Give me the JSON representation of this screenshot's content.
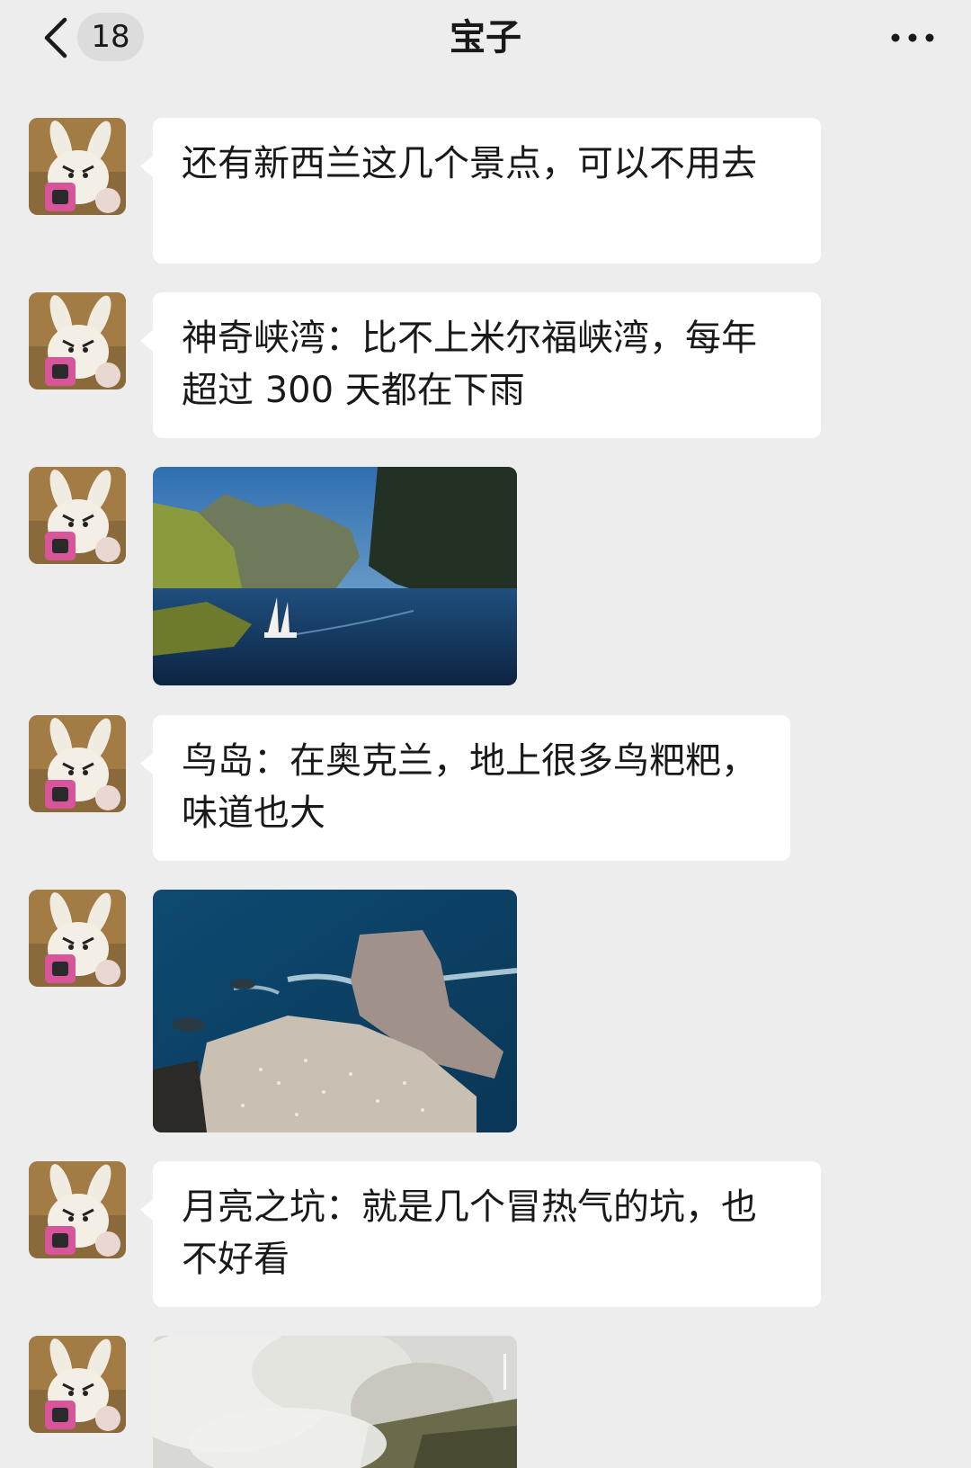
{
  "header": {
    "unread_count": "18",
    "title": "宝子"
  },
  "messages": [
    {
      "type": "text",
      "text": "还有新西兰这几个景点，可以不用去"
    },
    {
      "type": "text",
      "text": "神奇峡湾：比不上米尔福峡湾，每年超过 300 天都在下雨"
    },
    {
      "type": "image",
      "subject": "fiord with sailing ship"
    },
    {
      "type": "text",
      "text": "鸟岛：在奥克兰，地上很多鸟粑粑，味道也大"
    },
    {
      "type": "image",
      "subject": "gannet colony on rocky headland"
    },
    {
      "type": "text",
      "text": "月亮之坑：就是几个冒热气的坑，也不好看"
    },
    {
      "type": "image",
      "subject": "steaming geothermal craters"
    }
  ],
  "colors": {
    "background": "#ededed",
    "bubble": "#ffffff",
    "badge": "#dcdcdc"
  },
  "icons": {
    "back": "chevron-left-icon",
    "more": "more-dots-icon",
    "avatar": "bunny-avatar-icon"
  }
}
